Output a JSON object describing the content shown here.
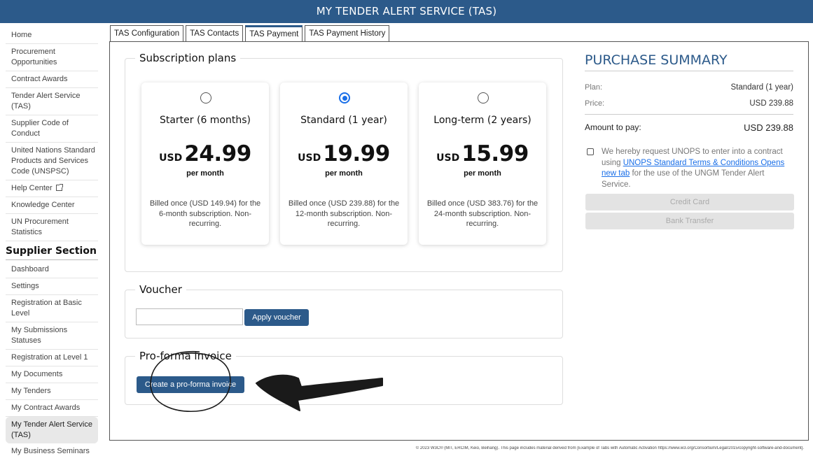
{
  "header": {
    "title": "MY TENDER ALERT SERVICE (TAS)"
  },
  "sidebar": {
    "items": [
      {
        "label": "Home"
      },
      {
        "label": "Procurement Opportunities"
      },
      {
        "label": "Contract Awards"
      },
      {
        "label": "Tender Alert Service (TAS)"
      },
      {
        "label": "Supplier Code of Conduct"
      },
      {
        "label": "United Nations Standard Products and Services Code (UNSPSC)"
      },
      {
        "label": "Help Center"
      },
      {
        "label": "Knowledge Center"
      },
      {
        "label": "UN Procurement Statistics"
      }
    ],
    "section_title": "Supplier Section",
    "supplier_items": [
      {
        "label": "Dashboard"
      },
      {
        "label": "Settings"
      },
      {
        "label": "Registration at Basic Level"
      },
      {
        "label": "My Submissions Statuses"
      },
      {
        "label": "Registration at Level 1"
      },
      {
        "label": "My Documents"
      },
      {
        "label": "My Tenders"
      },
      {
        "label": "My Contract Awards"
      },
      {
        "label": "My Tender Alert Service (TAS)"
      },
      {
        "label": "My Business Seminars"
      }
    ]
  },
  "tabs": [
    {
      "label": "TAS Configuration"
    },
    {
      "label": "TAS Contacts"
    },
    {
      "label": "TAS Payment"
    },
    {
      "label": "TAS Payment History"
    }
  ],
  "subscription": {
    "title": "Subscription plans",
    "plans": [
      {
        "name": "Starter (6 months)",
        "currency": "USD",
        "amount": "24.99",
        "per": "per month",
        "note": "Billed once (USD 149.94) for the 6-month subscription. Non-recurring.",
        "selected": false
      },
      {
        "name": "Standard (1 year)",
        "currency": "USD",
        "amount": "19.99",
        "per": "per month",
        "note": "Billed once (USD 239.88) for the 12-month subscription. Non-recurring.",
        "selected": true
      },
      {
        "name": "Long-term (2 years)",
        "currency": "USD",
        "amount": "15.99",
        "per": "per month",
        "note": "Billed once (USD 383.76) for the 24-month subscription. Non-recurring.",
        "selected": false
      }
    ]
  },
  "voucher": {
    "title": "Voucher",
    "input_value": "",
    "apply_label": "Apply voucher"
  },
  "proforma": {
    "title": "Pro-forma invoice",
    "button_label": "Create a pro-forma invoice"
  },
  "summary": {
    "title": "PURCHASE SUMMARY",
    "plan_label": "Plan:",
    "plan_value": "Standard (1 year)",
    "price_label": "Price:",
    "price_value": "USD 239.88",
    "amount_label": "Amount to pay:",
    "amount_value": "USD 239.88",
    "agree_text_1": "We hereby request UNOPS to enter into a contract using ",
    "agree_link": "UNOPS Standard Terms & Conditions Opens new tab",
    "agree_text_2": " for the use of the UNGM Tender Alert Service.",
    "credit_card_label": "Credit Card",
    "bank_transfer_label": "Bank Transfer"
  },
  "footer": {
    "text": "© 2023 W3C® (MIT, ERCIM, Keio, Beihang). This page includes material derived from [Example of Tabs with Automatic Activation https://www.w3.org/Consortium/Legal/2015/copyright-software-and-document]."
  },
  "colors": {
    "brand": "#2c5a8a",
    "radio_accent": "#1a6fe8",
    "annotation": "#1a1a1a"
  },
  "icons": {
    "help_center": "external-link-icon"
  }
}
